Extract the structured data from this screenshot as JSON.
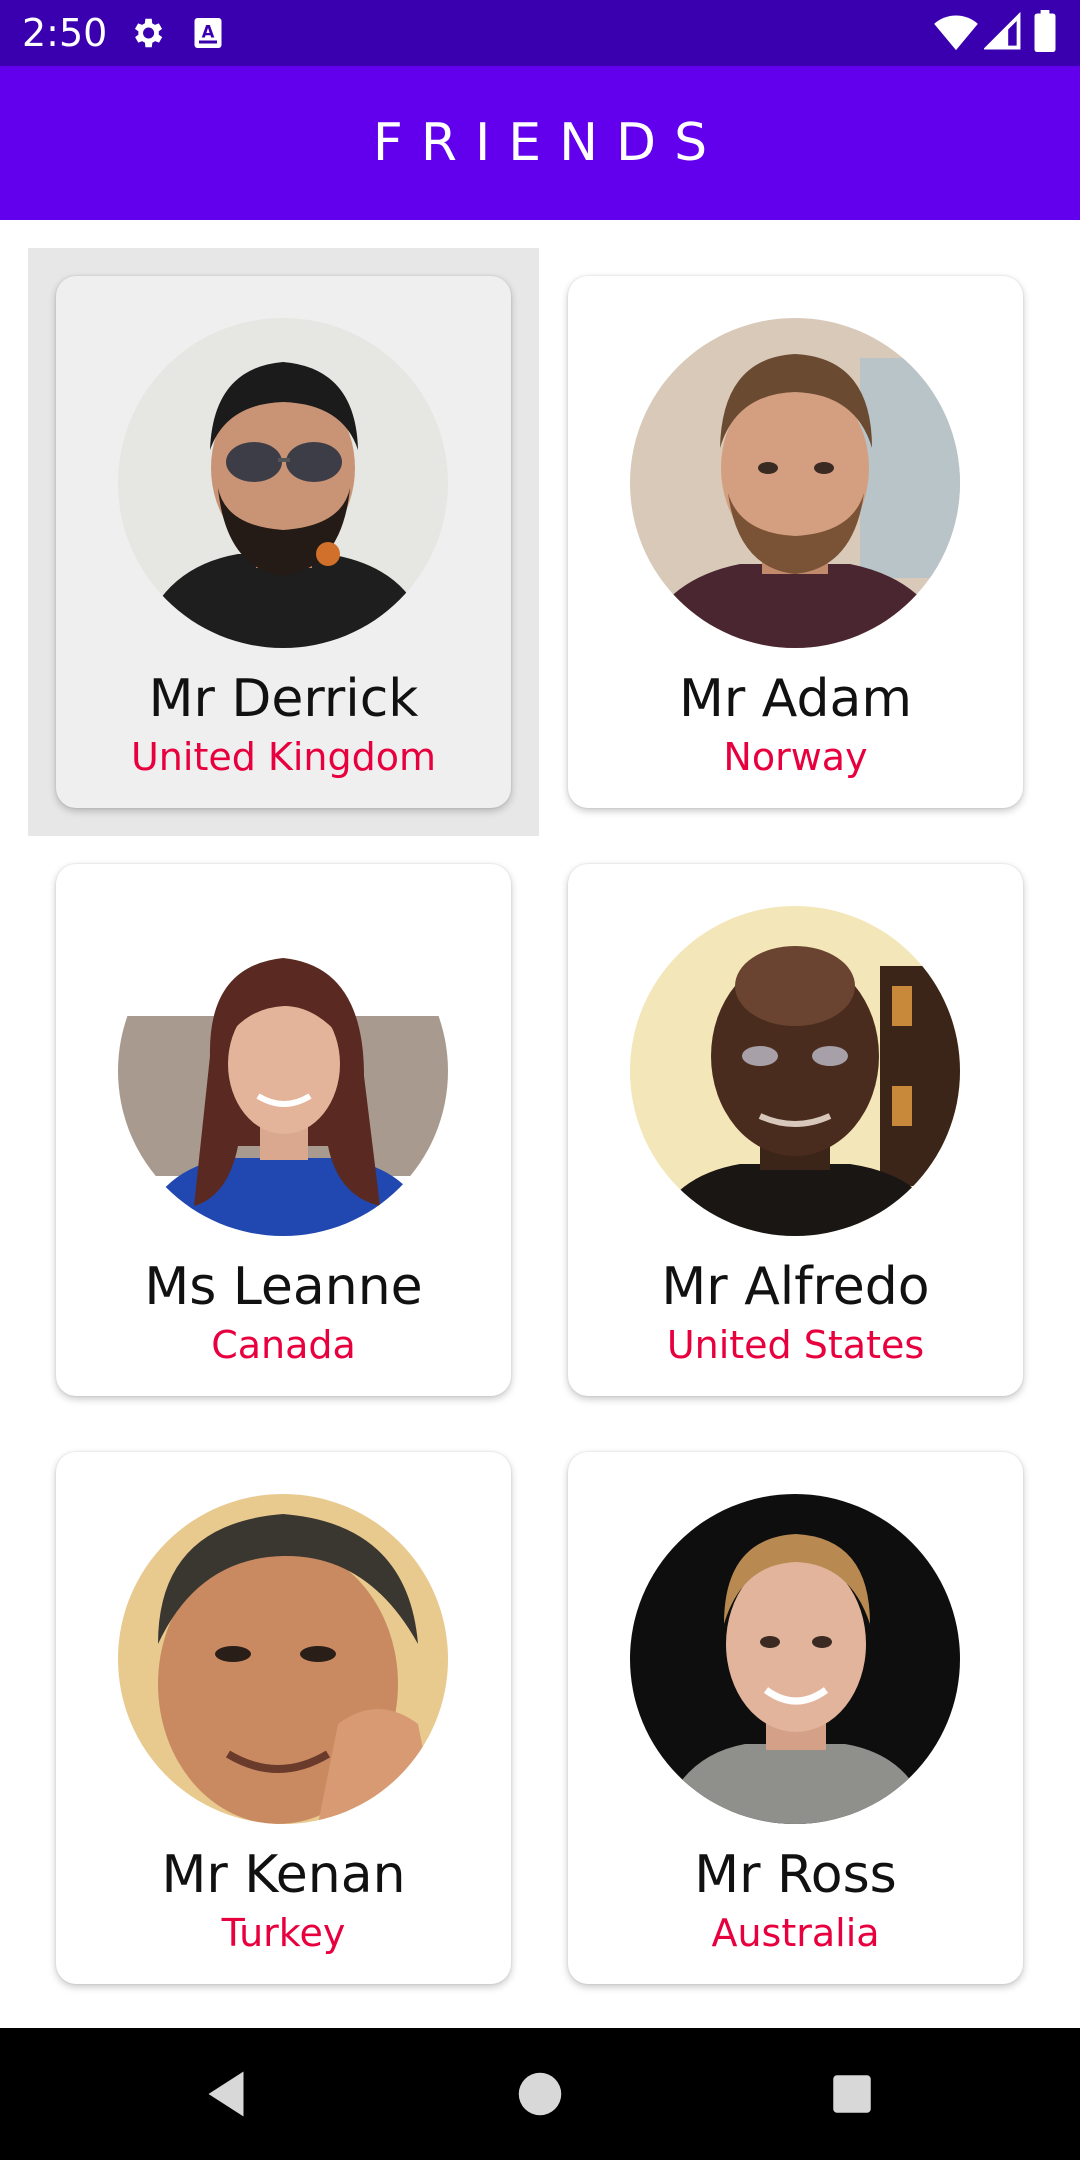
{
  "status_bar": {
    "time": "2:50",
    "icons": [
      "gear-icon",
      "a-badge-icon",
      "wifi-icon",
      "signal-icon",
      "battery-icon"
    ]
  },
  "app_bar": {
    "title": "FRIENDS",
    "background": "#6200ee"
  },
  "friends": [
    {
      "name": "Mr Derrick",
      "country": "United Kingdom",
      "selected": true
    },
    {
      "name": "Mr Adam",
      "country": "Norway",
      "selected": false
    },
    {
      "name": "Ms Leanne",
      "country": "Canada",
      "selected": false
    },
    {
      "name": "Mr Alfredo",
      "country": "United States",
      "selected": false
    },
    {
      "name": "Mr Kenan",
      "country": "Turkey",
      "selected": false
    },
    {
      "name": "Mr Ross",
      "country": "Australia",
      "selected": false
    }
  ],
  "colors": {
    "accent": "#6200ee",
    "status_bar": "#3a00b0",
    "country_text": "#e8003e"
  },
  "nav_bar": {
    "icons": [
      "back-icon",
      "home-icon",
      "recents-icon"
    ]
  }
}
